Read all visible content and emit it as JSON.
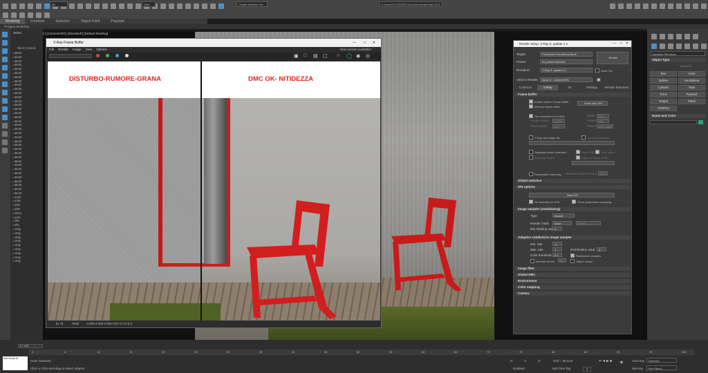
{
  "toolbar": {
    "filter_dropdown": "All",
    "view_dropdown": "View",
    "selection_set_placeholder": "Create Selection Se",
    "path": "C:\\Users\\STUDIO\\PC\\Documents\\3ds Max 2022"
  },
  "tabs": [
    {
      "label": "Modeling",
      "active": true
    },
    {
      "label": "Freeform",
      "active": false
    },
    {
      "label": "Selection",
      "active": false
    },
    {
      "label": "Object Paint",
      "active": false
    },
    {
      "label": "Populate",
      "active": false
    }
  ],
  "ribbon_label": "Polygon Modeling",
  "explorer": {
    "select_label": "Select",
    "header": "Name (Sorted",
    "items": [
      "Box0",
      "Box0",
      "Box0",
      "Box0",
      "Box0",
      "Box0",
      "Box0",
      "Box0",
      "Box0",
      "Box0",
      "Box0",
      "Box0",
      "Box0",
      "Box0",
      "Box0",
      "Box0",
      "Box0",
      "Box0",
      "Box0",
      "Box0",
      "Box0",
      "Box0",
      "Box0",
      "Box0",
      "Box0",
      "Box0",
      "Box0",
      "Box0",
      "Box0",
      "Box0",
      "Box0",
      "Box0",
      "Box0",
      "Box0",
      "Box0",
      "Box0",
      "Cam",
      "Cam",
      "Dire",
      "Dire",
      "Grou",
      "Line",
      "Pla",
      "Pla",
      "Vray",
      "Vray",
      "Vray",
      "Vray",
      "Vray",
      "Vray",
      "Vray",
      "Vray",
      "Vray"
    ]
  },
  "viewport_label": "[+] [CameraVRC] [Standard*] [Default Shading]",
  "frame_buffer": {
    "title": "V-Ray Frame Buffer",
    "menu": [
      "File",
      "Render",
      "Image",
      "View",
      "Options"
    ],
    "new_version": "New version available!",
    "left_label": "DISTURBO-RUMORE-GRANA",
    "right_label": "DMC OK- NITIDEZZA",
    "status_coords": "[0, 0]",
    "status_mode": "RGB",
    "status_values": "0.000    0.000    0.000    HSV    0    0.0    0.0"
  },
  "render_setup": {
    "title": "Render Setup: V-Ray 5, update 1.2",
    "target_label": "Target:",
    "target_value": "Production Rendering Mode",
    "preset_label": "Preset:",
    "preset_value": "No preset selected",
    "renderer_label": "Renderer:",
    "renderer_value": "V-Ray 5, update 1.2",
    "save_file": "Save File",
    "render_button": "Render",
    "view_label": "View to Render:",
    "view_value": "Quad 4 - CameraVRC",
    "tabs": [
      {
        "label": "Common",
        "active": false
      },
      {
        "label": "V-Ray",
        "active": true
      },
      {
        "label": "GI",
        "active": false
      },
      {
        "label": "Settings",
        "active": false
      },
      {
        "label": "Render Elements",
        "active": false
      }
    ],
    "frame_buffer_section": "Frame buffer",
    "enable_fb": "Enable built-in Frame Buffer",
    "memory_fb": "Memory frame buffer",
    "show_last": "Show last VFB",
    "get_resolution": "Get resolution from MAX",
    "image_aspect": "Image aspect",
    "pixel_aspect": "Pixel aspect",
    "width": "Width",
    "height": "Height",
    "preset": "Preset",
    "aspect_value": "1.333",
    "pixel_value": "1.0",
    "width_value": "640",
    "height_value": "480",
    "preset_sel": "640 x 480",
    "raw_image": "V-Ray raw image file",
    "generate_preview": "Generate preview",
    "separate_channels": "Separate render channels",
    "save_rgb": "Save RGB",
    "save_alpha": "Save alpha",
    "separate_folders": "Separate folders",
    "export_maxfile": "Export in frame buffer",
    "resumable": "Resumable rendering",
    "autosave": "Autosave interval (min)",
    "autosave_value": "0.0",
    "global_switches": "Global switches",
    "ipr_options": "IPR options",
    "start_ipr": "Start IPR",
    "fit_resolution": "Fit resolution to VFB",
    "force_progressive": "Force progressive sampling",
    "image_sampler": "Image sampler (Antialiasing)",
    "type_label": "Type",
    "type_value": "Bucket",
    "render_mask": "Render mask",
    "render_mask_value": "None",
    "min_shading": "Min shading rate",
    "min_shading_value": "6",
    "adaptive": "Adaptive subdivision image sampler",
    "min_rate": "Min. rate",
    "min_rate_value": "-1",
    "max_rate": "Max. rate",
    "max_rate_value": "2",
    "color_threshold": "Color threshold",
    "color_threshold_value": "0.1",
    "dof": "DOF/motion subd",
    "dof_value": "4",
    "randomize": "Randomize samples",
    "object_outline": "Object outline",
    "normals": "Normals thresh",
    "normals_value": "0.1",
    "image_filter": "Image filter",
    "global_dmc": "Global DMC",
    "environment": "Environment",
    "color_mapping": "Color mapping",
    "camera": "Camera",
    "object_label": "Object"
  },
  "command_panel": {
    "category": "Standard Primitives",
    "rollout_title": "Object Type",
    "autogrid": "AutoGrid",
    "buttons": [
      "Box",
      "Cone",
      "Sphere",
      "GeoSphere",
      "Cylinder",
      "Tube",
      "Torus",
      "Pyramid",
      "Teapot",
      "Plane",
      "TextPlus"
    ],
    "name_color": "Name and Color"
  },
  "bottom": {
    "zoom": "0 / 100",
    "status_line1": "None Selected",
    "status_line2": "Click or click-and-drag to select objects",
    "x_label": "X:",
    "y_label": "Y:",
    "z_label": "Z:",
    "grid": "Grid = 25,4cm",
    "add_time_tag": "Add Time Tag",
    "enabled": "Enabled:",
    "auto_key": "Auto Key",
    "set_key": "Set Key",
    "selected": "Selected",
    "key_filters": "Key Filters...",
    "frame": "0",
    "maxscript": "MAXScript Mi",
    "ticks": [
      "0",
      "5",
      "10",
      "15",
      "20",
      "25",
      "30",
      "35",
      "40",
      "45",
      "50",
      "55",
      "60",
      "65",
      "70",
      "75",
      "80",
      "85",
      "90",
      "95",
      "100"
    ]
  },
  "colors": {
    "label_red": "#e0241f",
    "chair_red": "#d21e1e",
    "accent_blue": "#4a90c8",
    "panel": "#3b3b3b"
  }
}
